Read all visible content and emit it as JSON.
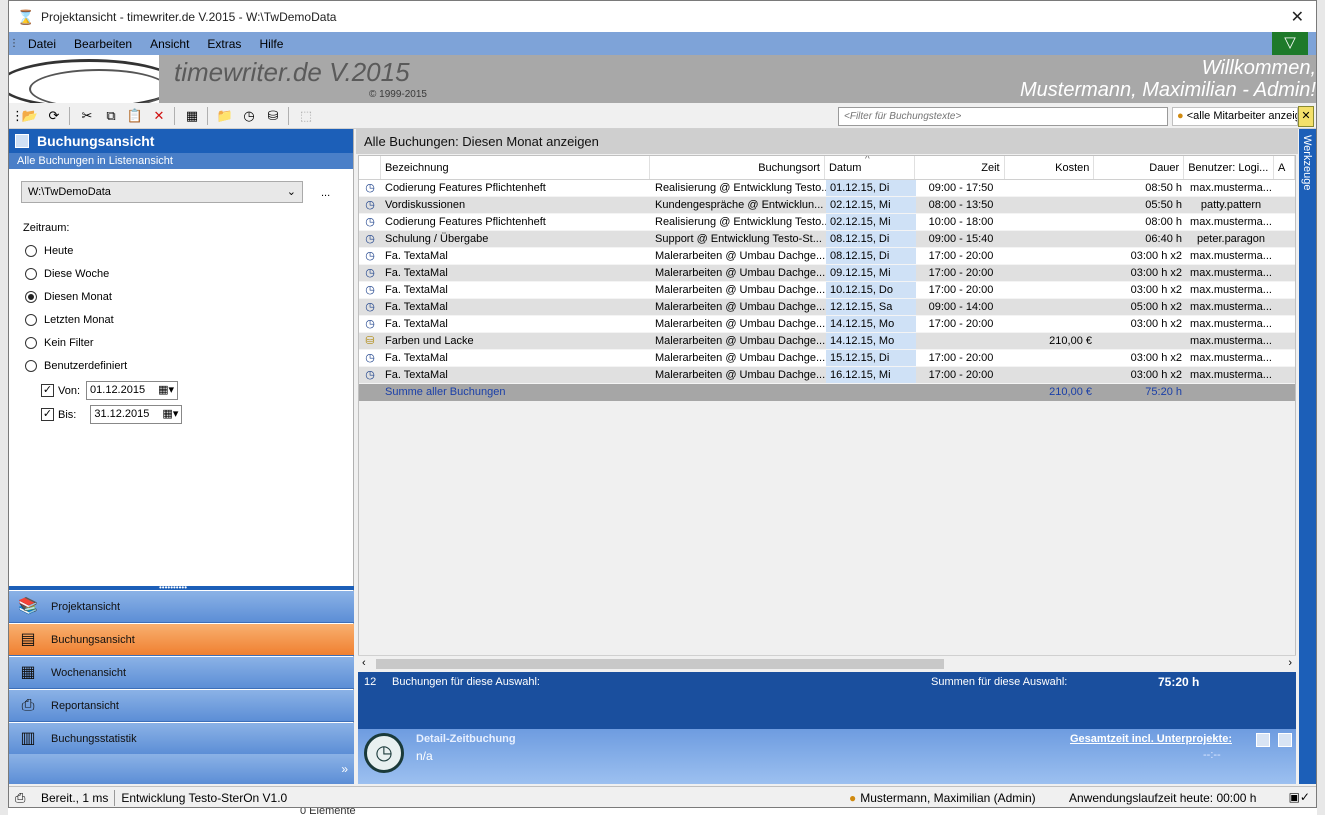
{
  "window": {
    "title": "Projektansicht - timewriter.de V.2015 - W:\\TwDemoData"
  },
  "menu": {
    "items": [
      "Datei",
      "Bearbeiten",
      "Ansicht",
      "Extras",
      "Hilfe"
    ]
  },
  "banner": {
    "logo_text": "timewriter.de V.2015",
    "copyright": "© 1999-2015",
    "welcome_line1": "Willkommen,",
    "welcome_line2": "Mustermann, Maximilian  - Admin!"
  },
  "toolbar": {
    "filter_placeholder": "<Filter für Buchungstexte>",
    "employee_filter": "<alle Mitarbeiter anzeigen>",
    "close_glyph": "✕"
  },
  "left": {
    "header": "Buchungsansicht",
    "subheader": "Alle Buchungen in Listenansicht",
    "path": "W:\\TwDemoData",
    "path_more": "...",
    "zeitraum_label": "Zeitraum:",
    "options": [
      "Heute",
      "Diese Woche",
      "Diesen Monat",
      "Letzten Monat",
      "Kein Filter",
      "Benutzerdefiniert"
    ],
    "selected_option": "Diesen Monat",
    "von_label": "Von:",
    "von_date": "01.12.2015",
    "bis_label": "Bis:",
    "bis_date": "31.12.2015"
  },
  "nav": {
    "items": [
      "Projektansicht",
      "Buchungsansicht",
      "Wochenansicht",
      "Reportansicht",
      "Buchungsstatistik"
    ],
    "active": "Buchungsansicht",
    "expand_glyph": "»"
  },
  "main": {
    "header": "Alle Buchungen: Diesen Monat anzeigen",
    "columns": [
      "Bezeichnung",
      "Buchungsort",
      "Datum",
      "Zeit",
      "Kosten",
      "Dauer",
      "Benutzer: Logi...",
      "A"
    ],
    "rows": [
      {
        "icon": "clock",
        "bez": "Codierung Features Pflichtenheft",
        "ort": "Realisierung @ Entwicklung Testo...",
        "datum": "01.12.15, Di",
        "zeit": "09:00 - 17:50",
        "kosten": "",
        "dauer": "08:50 h",
        "user": "max.musterma..."
      },
      {
        "icon": "clock",
        "bez": "Vordiskussionen",
        "ort": "Kundengespräche @ Entwicklun...",
        "datum": "02.12.15, Mi",
        "zeit": "08:00 - 13:50",
        "kosten": "",
        "dauer": "05:50 h",
        "user": "patty.pattern"
      },
      {
        "icon": "clock",
        "bez": "Codierung Features Pflichtenheft",
        "ort": "Realisierung @ Entwicklung Testo...",
        "datum": "02.12.15, Mi",
        "zeit": "10:00 - 18:00",
        "kosten": "",
        "dauer": "08:00 h",
        "user": "max.musterma..."
      },
      {
        "icon": "clock",
        "bez": "Schulung / Übergabe",
        "ort": "Support @ Entwicklung Testo-St...",
        "datum": "08.12.15, Di",
        "zeit": "09:00 - 15:40",
        "kosten": "",
        "dauer": "06:40 h",
        "user": "peter.paragon"
      },
      {
        "icon": "clock",
        "bez": "Fa. TextaMal",
        "ort": "Malerarbeiten @ Umbau Dachge...",
        "datum": "08.12.15, Di",
        "zeit": "17:00 - 20:00",
        "kosten": "",
        "dauer": "03:00 h x2",
        "user": "max.musterma..."
      },
      {
        "icon": "clock",
        "bez": "Fa. TextaMal",
        "ort": "Malerarbeiten @ Umbau Dachge...",
        "datum": "09.12.15, Mi",
        "zeit": "17:00 - 20:00",
        "kosten": "",
        "dauer": "03:00 h x2",
        "user": "max.musterma..."
      },
      {
        "icon": "clock",
        "bez": "Fa. TextaMal",
        "ort": "Malerarbeiten @ Umbau Dachge...",
        "datum": "10.12.15, Do",
        "zeit": "17:00 - 20:00",
        "kosten": "",
        "dauer": "03:00 h x2",
        "user": "max.musterma..."
      },
      {
        "icon": "clock",
        "bez": "Fa. TextaMal",
        "ort": "Malerarbeiten @ Umbau Dachge...",
        "datum": "12.12.15, Sa",
        "zeit": "09:00 - 14:00",
        "kosten": "",
        "dauer": "05:00 h x2",
        "user": "max.musterma..."
      },
      {
        "icon": "clock",
        "bez": "Fa. TextaMal",
        "ort": "Malerarbeiten @ Umbau Dachge...",
        "datum": "14.12.15, Mo",
        "zeit": "17:00 - 20:00",
        "kosten": "",
        "dauer": "03:00 h x2",
        "user": "max.musterma..."
      },
      {
        "icon": "coins",
        "bez": "Farben und Lacke",
        "ort": "Malerarbeiten @ Umbau Dachge...",
        "datum": "14.12.15, Mo",
        "zeit": "",
        "kosten": "210,00 €",
        "dauer": "",
        "user": "max.musterma..."
      },
      {
        "icon": "clock",
        "bez": "Fa. TextaMal",
        "ort": "Malerarbeiten @ Umbau Dachge...",
        "datum": "15.12.15, Di",
        "zeit": "17:00 - 20:00",
        "kosten": "",
        "dauer": "03:00 h x2",
        "user": "max.musterma..."
      },
      {
        "icon": "clock",
        "bez": "Fa. TextaMal",
        "ort": "Malerarbeiten @ Umbau Dachge...",
        "datum": "16.12.15, Mi",
        "zeit": "17:00 - 20:00",
        "kosten": "",
        "dauer": "03:00 h x2",
        "user": "max.musterma..."
      }
    ],
    "sum_label": "Summe aller Buchungen",
    "sum_kosten": "210,00 €",
    "sum_dauer": "75:20 h"
  },
  "summary": {
    "count": "12",
    "count_label": "Buchungen für diese Auswahl:",
    "sums_label": "Summen für diese Auswahl:",
    "sums_value": "75:20 h"
  },
  "detail": {
    "title": "Detail-Zeitbuchung",
    "value": "n/a",
    "gesamt_label": "Gesamtzeit incl. Unterprojekte:",
    "gesamt_value": "--:--"
  },
  "side": {
    "werkzeuge": "Werkzeuge"
  },
  "status": {
    "ready": "Bereit., 1 ms",
    "project": "Entwicklung Testo-SterOn V1.0",
    "user": "Mustermann, Maximilian  (Admin)",
    "runtime": "Anwendungslaufzeit heute: 00:00 h"
  },
  "background": {
    "elements": "0 Elemente"
  },
  "colors": {
    "header_blue": "#1c5fb8",
    "menu_blue": "#7ea3d8",
    "active_orange": "#f08030",
    "summary_blue": "#1a4f9e",
    "filter_green": "#1e7a2a"
  }
}
